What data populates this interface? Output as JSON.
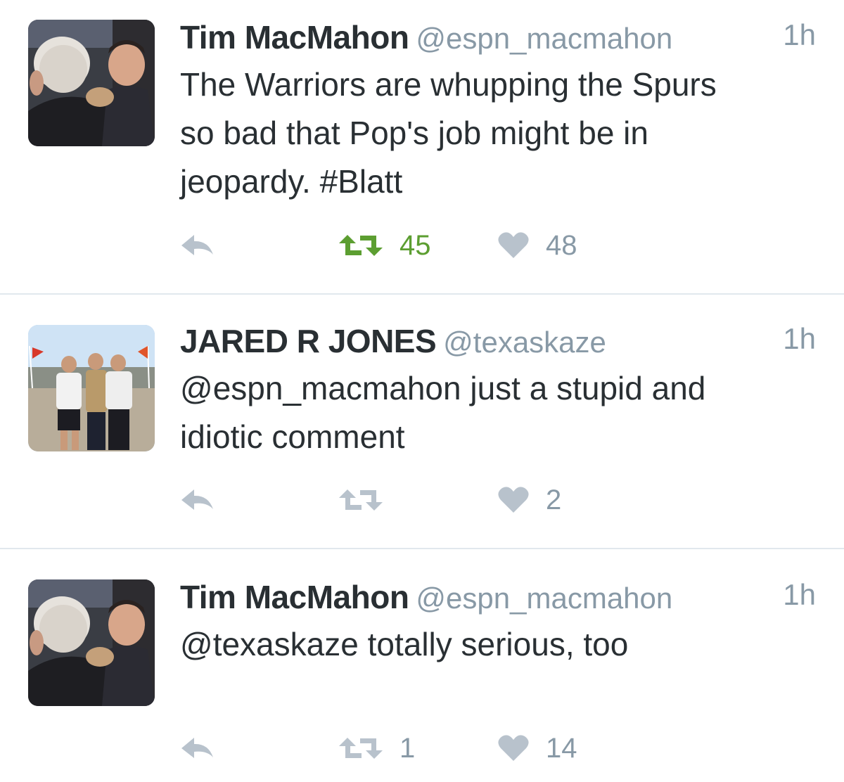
{
  "tweets": [
    {
      "name": "Tim MacMahon",
      "handle": "@espn_macmahon",
      "time": "1h",
      "text": "The Warriors are whupping the Spurs\nso bad that Pop's job might be in\njeopardy. #Blatt",
      "retweets": "45",
      "likes": "48",
      "retweeted": true
    },
    {
      "name": "JARED R JONES",
      "handle": "@texaskaze",
      "time": "1h",
      "text": "@espn_macmahon just a stupid and\nidiotic comment",
      "retweets": "",
      "likes": "2",
      "retweeted": false
    },
    {
      "name": "Tim MacMahon",
      "handle": "@espn_macmahon",
      "time": "1h",
      "text": "@texaskaze totally serious, too",
      "retweets": "1",
      "likes": "14",
      "retweeted": false
    }
  ],
  "colors": {
    "text": "#292f33",
    "muted": "#8899a6",
    "icon": "#b8c2cc",
    "retweet_active": "#5c9e31",
    "divider": "#e1e8ed"
  }
}
